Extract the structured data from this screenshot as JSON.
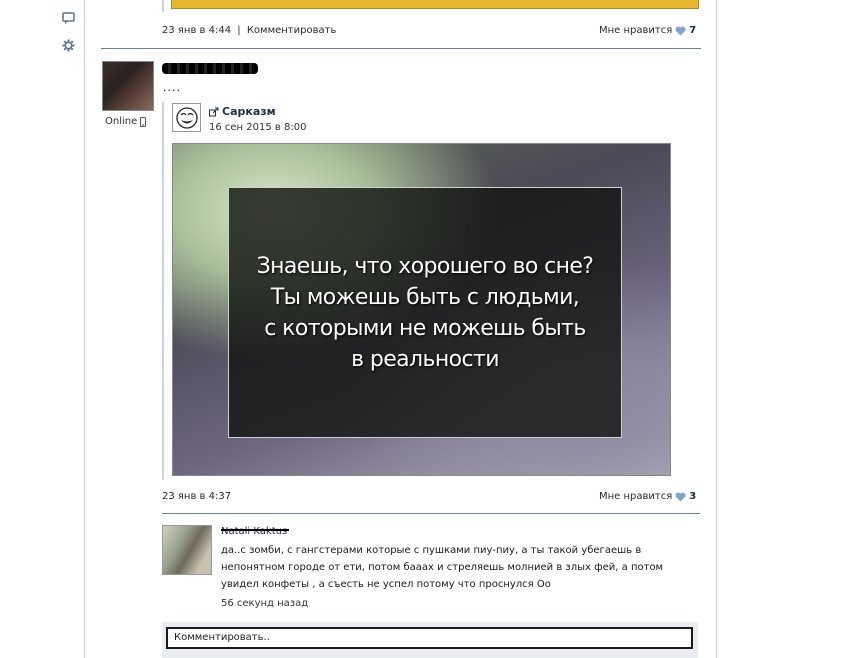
{
  "left_rail": {
    "icons": [
      "comment-icon",
      "gear-icon"
    ]
  },
  "previous_post": {
    "date": "23 янв в 4:44",
    "separator": "|",
    "comment_link": "Комментировать",
    "like_label": "Мне нравится",
    "like_count": "7"
  },
  "post": {
    "author_name": "",
    "status": "Online",
    "text": "....",
    "repost": {
      "source_name": "Сарказм",
      "source_date": "16 сен 2015 в 8:00",
      "image_text": [
        "Знаешь, что хорошего во сне?",
        "Ты можешь быть с людьми,",
        "с которыми не можешь быть",
        "в реальности"
      ]
    },
    "date": "23 янв в 4:37",
    "like_label": "Мне нравится",
    "like_count": "3"
  },
  "comment": {
    "author": "Natali Kaktus",
    "text": "да..с зомби, с гангстерами которые с пушками пиу-пиу, а ты такой убегаешь в непонятном городе от ети, потом бааах и стреляешь молнией в злых фей, а потом увидел конфеты , а съесть не успел потому что проснулся Оо",
    "time": "56 секунд назад"
  },
  "reply_box": {
    "placeholder": "Комментировать.."
  },
  "colors": {
    "link": "#1f2f44",
    "separator": "#6e7f94",
    "heart": "#7fa6c8"
  }
}
